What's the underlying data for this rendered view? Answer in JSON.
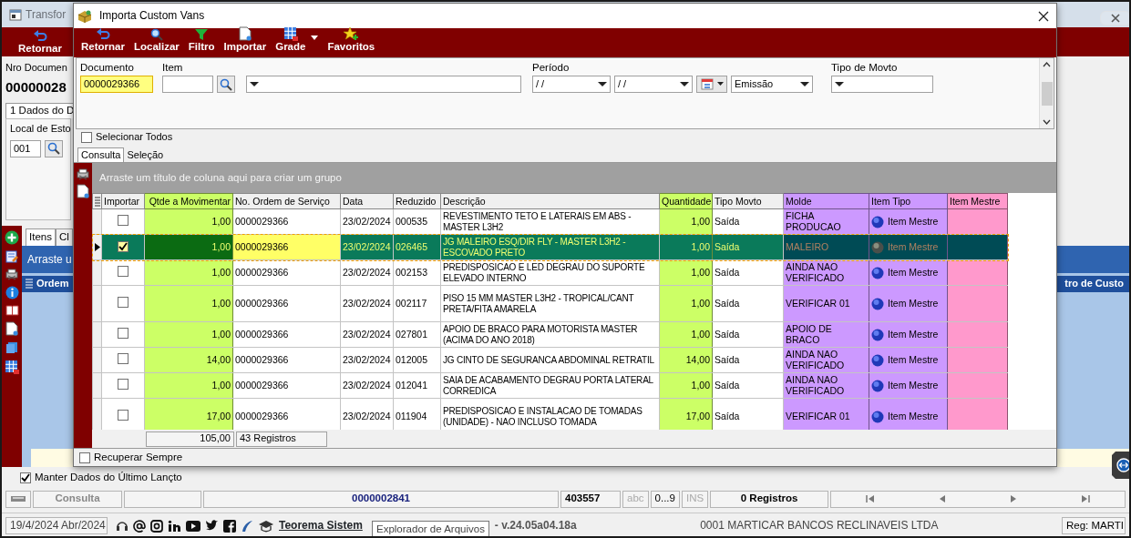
{
  "background_window": {
    "title": "Transfor",
    "toolbar": [
      "Retornar"
    ],
    "document_label": "Nro Documen",
    "document_value": "00000028",
    "tab": "1 Dados do D",
    "stock_group_label": "Local de Esto",
    "stock_value": "001",
    "lower_tabs": [
      {
        "label": "Itens",
        "selected": true
      },
      {
        "label": "Cl",
        "selected": false
      }
    ],
    "group_hint": "Arraste u",
    "grid_columns": [
      "Ordem",
      "tro de Custo"
    ],
    "keep_last": {
      "label": "Manter Dados do Último Lançto",
      "checked": true
    },
    "status_bar": {
      "mode": "Consulta",
      "document": "0000002841",
      "code": "403557",
      "indicators": [
        {
          "label": "abc",
          "on": false
        },
        {
          "label": "0...9",
          "on": true
        },
        {
          "label": "INS",
          "on": false
        }
      ],
      "records": "0 Registros"
    }
  },
  "taskbar": {
    "date": "19/4/2024 Abr/2024",
    "link": "Teorema Sistem",
    "version": "- v.24.05a04.18a",
    "company": "0001 MARTICAR BANCOS RECLINAVEIS LTDA",
    "user": "Reg: MARTI"
  },
  "tooltip": "Explorador de Arquivos",
  "dialog": {
    "title": "Importa Custom Vans",
    "toolbar": [
      "Retornar",
      "Localizar",
      "Filtro",
      "Importar",
      "Grade",
      "Favoritos"
    ],
    "filters": {
      "document_label": "Documento",
      "document_value": "0000029366",
      "item_label": "Item",
      "period_label": "Período",
      "date_from": "/ /",
      "date_to": "/ /",
      "date_type": "Emissão",
      "movement_type_label": "Tipo de Movto"
    },
    "select_all": {
      "label": "Selecionar Todos",
      "checked": false
    },
    "tabs": [
      {
        "label": "Consulta",
        "selected": true
      },
      {
        "label": "Seleção",
        "selected": false
      }
    ],
    "group_hint": "Arraste um título de coluna aqui para criar um grupo",
    "columns": [
      {
        "label": "Importar",
        "kind": "check"
      },
      {
        "label": "Qtde a Movimentar",
        "kind": "number",
        "color": "#ccff66"
      },
      {
        "label": "No. Ordem de Serviço",
        "kind": "text"
      },
      {
        "label": "Data",
        "kind": "text"
      },
      {
        "label": "Reduzido",
        "kind": "text"
      },
      {
        "label": "Descrição",
        "kind": "text"
      },
      {
        "label": "Quantidade",
        "kind": "number",
        "color": "#ccff66"
      },
      {
        "label": "Tipo Movto",
        "kind": "text"
      },
      {
        "label": "Molde",
        "kind": "text",
        "color": "#cc99ff"
      },
      {
        "label": "Item Tipo",
        "kind": "icon_text",
        "color": "#cc99ff"
      },
      {
        "label": "Item Mestre",
        "kind": "blank",
        "color": "#ff99cc"
      }
    ],
    "rows": [
      {
        "checked": false,
        "selected": false,
        "cells": [
          "",
          "1,00",
          "0000029366",
          "23/02/2024",
          "000535",
          "REVESTIMENTO TETO E LATERAIS EM ABS - MASTER L3H2",
          "1,00",
          "Saída",
          "FICHA PRODUCAO",
          "Item Mestre",
          ""
        ]
      },
      {
        "checked": true,
        "selected": true,
        "cells": [
          "",
          "1,00",
          "0000029366",
          "23/02/2024",
          "026465",
          "JG MALEIRO ESQ/DIR FLY - MASTER L3H2 - ESCOVADO PRETO",
          "1,00",
          "Saída",
          "MALEIRO",
          "Item Mestre",
          ""
        ]
      },
      {
        "checked": false,
        "selected": false,
        "cells": [
          "",
          "1,00",
          "0000029366",
          "23/02/2024",
          "002153",
          "PREDISPOSICAO E LED DEGRAU DO SUPORTE ELEVADO INTERNO",
          "1,00",
          "Saída",
          "AINDA NAO VERIFICADO",
          "Item Mestre",
          ""
        ]
      },
      {
        "checked": false,
        "selected": false,
        "cells": [
          "",
          "1,00",
          "0000029366",
          "23/02/2024",
          "002117",
          "PISO 15 MM MASTER L3H2 - TROPICAL/CANT PRETA/FITA AMARELA",
          "1,00",
          "Saída",
          "VERIFICAR 01",
          "Item Mestre",
          ""
        ]
      },
      {
        "checked": false,
        "selected": false,
        "cells": [
          "",
          "1,00",
          "0000029366",
          "23/02/2024",
          "027801",
          "APOIO DE BRACO PARA MOTORISTA MASTER (ACIMA DO ANO 2018)",
          "1,00",
          "Saída",
          "APOIO DE BRACO",
          "Item Mestre",
          ""
        ]
      },
      {
        "checked": false,
        "selected": false,
        "cells": [
          "",
          "14,00",
          "0000029366",
          "23/02/2024",
          "012005",
          "JG CINTO DE SEGURANCA ABDOMINAL RETRATIL",
          "14,00",
          "Saída",
          "AINDA NAO VERIFICADO",
          "Item Mestre",
          ""
        ]
      },
      {
        "checked": false,
        "selected": false,
        "cells": [
          "",
          "1,00",
          "0000029366",
          "23/02/2024",
          "012041",
          "SAIA DE ACABAMENTO DEGRAU PORTA LATERAL CORREDICA",
          "1,00",
          "Saída",
          "AINDA NAO VERIFICADO",
          "Item Mestre",
          ""
        ]
      },
      {
        "checked": false,
        "selected": false,
        "cells": [
          "",
          "17,00",
          "0000029366",
          "23/02/2024",
          "011904",
          "PREDISPOSICAO E INSTALACAO DE TOMADAS (UNIDADE) - NAO INCLUSO TOMADA",
          "17,00",
          "Saída",
          "VERIFICAR 01",
          "Item Mestre",
          ""
        ]
      }
    ],
    "footer": {
      "total": "105,00",
      "count": "43 Registros"
    },
    "recover_always": {
      "label": "Recuperar Sempre",
      "checked": false
    }
  }
}
